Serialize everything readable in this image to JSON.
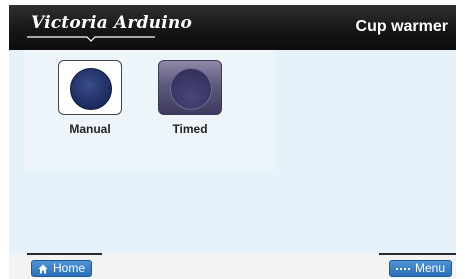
{
  "header": {
    "brand": "Victoria Arduino",
    "title": "Cup warmer"
  },
  "modes": [
    {
      "label": "Manual",
      "selected": false
    },
    {
      "label": "Timed",
      "selected": true
    }
  ],
  "footer": {
    "home_label": "Home",
    "menu_label": "Menu"
  },
  "colors": {
    "header_bg": "#151515",
    "content_bg": "#e6f2fa",
    "button_blue": "#2a6fb8",
    "knob_dark_blue": "#1c2a5e",
    "selected_purple": "#5e5a7e"
  },
  "icons": {
    "home": "home-icon",
    "menu": "menu-grid-icon",
    "logo_underline": "logo-underline-icon"
  }
}
